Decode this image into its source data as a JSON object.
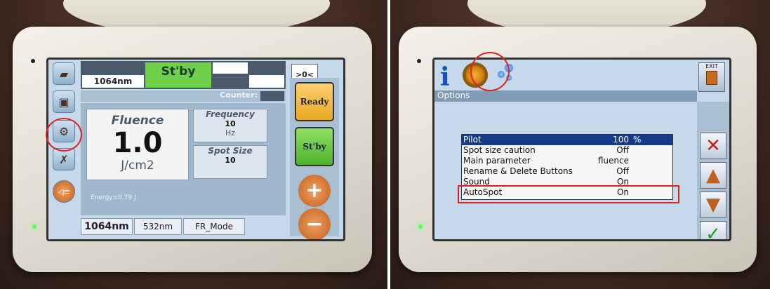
{
  "left_panel": {
    "wavelength_top": "1064nm",
    "status": "St'by",
    "zero_button": ">0<",
    "counter_label": "Counter:",
    "fluence": {
      "label": "Fluence",
      "value": "1.0",
      "unit": "J/cm2"
    },
    "frequency": {
      "label": "Frequency",
      "value": "10",
      "unit": "Hz"
    },
    "spot_size": {
      "label": "Spot Size",
      "value": "10"
    },
    "energy": "Energy=0.79 J",
    "bottom_tabs": [
      "1064nm",
      "532nm",
      "FR_Mode"
    ],
    "ready_button": "Ready",
    "stby_button": "St'by",
    "plus_symbol": "+",
    "minus_symbol": "−",
    "sidebar_icons": [
      "case-icon",
      "floppy-disk-icon",
      "settings-gear-icon",
      "tools-icon",
      "aiming-beam-icon"
    ],
    "highlight_color": "#e02020"
  },
  "right_panel": {
    "info_symbol": "i",
    "exit_label": "EXIT",
    "options_label": "Options",
    "options": [
      {
        "name": "Pilot",
        "value": "100",
        "unit": "%",
        "selected": true
      },
      {
        "name": "Spot size caution",
        "value": "Off",
        "unit": ""
      },
      {
        "name": "Main parameter",
        "value": "fluence",
        "unit": ""
      },
      {
        "name": "Rename & Delete Buttons",
        "value": "Off",
        "unit": ""
      },
      {
        "name": "Sound",
        "value": "On",
        "unit": ""
      },
      {
        "name": "AutoSpot",
        "value": "On",
        "unit": ""
      }
    ],
    "side_buttons": {
      "cancel": "✕",
      "up": "▲",
      "down": "▼",
      "confirm": "✓"
    }
  }
}
